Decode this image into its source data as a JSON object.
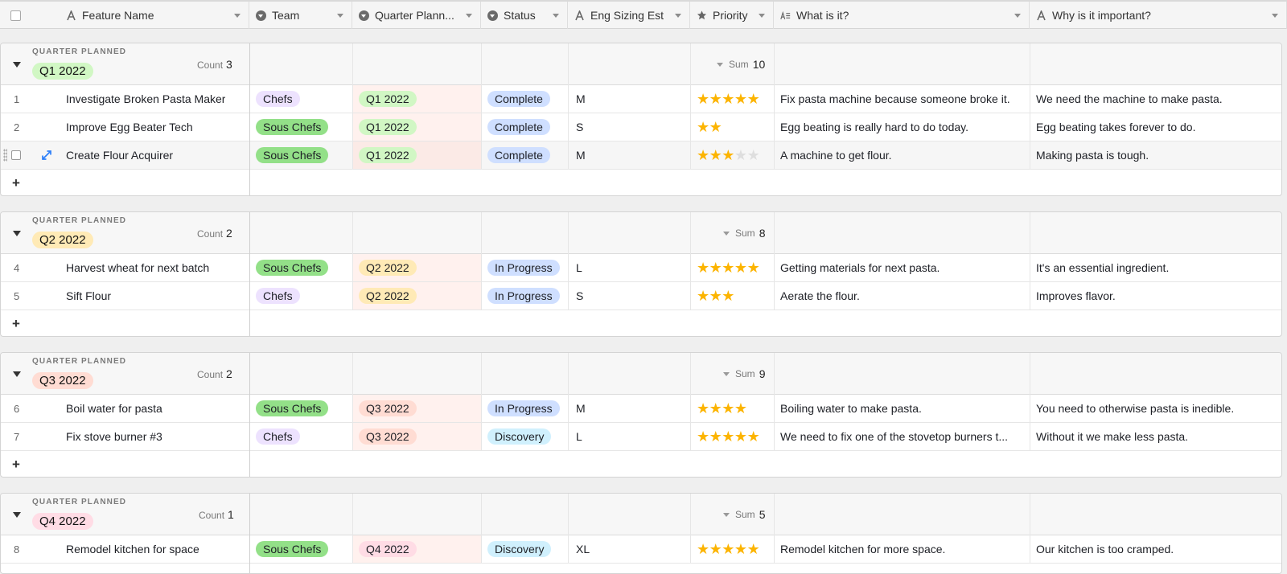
{
  "header": {
    "columns": [
      {
        "label": "Feature Name",
        "icon": "text-icon"
      },
      {
        "label": "Team",
        "icon": "single-select-icon"
      },
      {
        "label": "Quarter Plann...",
        "icon": "single-select-icon"
      },
      {
        "label": "Status",
        "icon": "single-select-icon"
      },
      {
        "label": "Eng Sizing Est",
        "icon": "text-icon"
      },
      {
        "label": "Priority",
        "icon": "star-icon"
      },
      {
        "label": "What is it?",
        "icon": "long-text-icon"
      },
      {
        "label": "Why is it important?",
        "icon": "text-icon"
      }
    ]
  },
  "colors": {
    "chefs": "#ede2fe",
    "sous_chefs": "#93e088",
    "q1": "#d1f7c4",
    "q2": "#ffeab6",
    "q3": "#ffdce5",
    "q4": "#ffdce5",
    "status_blue": "#cfdfff",
    "status_cyan": "#d0f0fd",
    "star": "#fcb400"
  },
  "groups": [
    {
      "group_label": "QUARTER PLANNED",
      "name": "Q1 2022",
      "color": "#d1f7c4",
      "count_label": "Count",
      "count": "3",
      "sum_label": "Sum",
      "sum": "10",
      "rows": [
        {
          "num": "1",
          "feature": "Investigate Broken Pasta Maker",
          "team": "Chefs",
          "quarter": "Q1 2022",
          "status": "Complete",
          "size": "M",
          "priority": 5,
          "what": "Fix pasta machine because someone broke it.",
          "why": "We need the machine to make pasta."
        },
        {
          "num": "2",
          "feature": "Improve Egg Beater Tech",
          "team": "Sous Chefs",
          "quarter": "Q1 2022",
          "status": "Complete",
          "size": "S",
          "priority": 2,
          "what": "Egg beating is really hard to do today.",
          "why": "Egg beating takes forever to do."
        },
        {
          "num": "",
          "feature": "Create Flour Acquirer",
          "team": "Sous Chefs",
          "quarter": "Q1 2022",
          "status": "Complete",
          "size": "M",
          "priority": 3,
          "what": "A machine to get flour.",
          "why": "Making pasta is tough.",
          "hovered": true
        }
      ]
    },
    {
      "group_label": "QUARTER PLANNED",
      "name": "Q2 2022",
      "color": "#ffeab6",
      "count_label": "Count",
      "count": "2",
      "sum_label": "Sum",
      "sum": "8",
      "rows": [
        {
          "num": "4",
          "feature": "Harvest wheat for next batch",
          "team": "Sous Chefs",
          "quarter": "Q2 2022",
          "status": "In Progress",
          "size": "L",
          "priority": 5,
          "what": "Getting materials for next pasta.",
          "why": "It's an essential ingredient."
        },
        {
          "num": "5",
          "feature": "Sift Flour",
          "team": "Chefs",
          "quarter": "Q2 2022",
          "status": "In Progress",
          "size": "S",
          "priority": 3,
          "what": "Aerate the flour.",
          "why": "Improves flavor."
        }
      ]
    },
    {
      "group_label": "QUARTER PLANNED",
      "name": "Q3 2022",
      "color": "#ffdcd3",
      "count_label": "Count",
      "count": "2",
      "sum_label": "Sum",
      "sum": "9",
      "rows": [
        {
          "num": "6",
          "feature": "Boil water for pasta",
          "team": "Sous Chefs",
          "quarter": "Q3 2022",
          "status": "In Progress",
          "size": "M",
          "priority": 4,
          "what": "Boiling water to make pasta.",
          "why": "You need to otherwise pasta is inedible."
        },
        {
          "num": "7",
          "feature": "Fix stove burner #3",
          "team": "Chefs",
          "quarter": "Q3 2022",
          "status": "Discovery",
          "size": "L",
          "priority": 5,
          "what": "We need to fix one of the stovetop burners t...",
          "why": "Without it we make less pasta."
        }
      ]
    },
    {
      "group_label": "QUARTER PLANNED",
      "name": "Q4 2022",
      "color": "#ffdce5",
      "count_label": "Count",
      "count": "1",
      "sum_label": "Sum",
      "sum": "5",
      "rows": [
        {
          "num": "8",
          "feature": "Remodel kitchen for space",
          "team": "Sous Chefs",
          "quarter": "Q4 2022",
          "status": "Discovery",
          "size": "XL",
          "priority": 5,
          "what": "Remodel kitchen for more space.",
          "why": "Our kitchen is too cramped."
        }
      ]
    }
  ],
  "add_label": "+"
}
